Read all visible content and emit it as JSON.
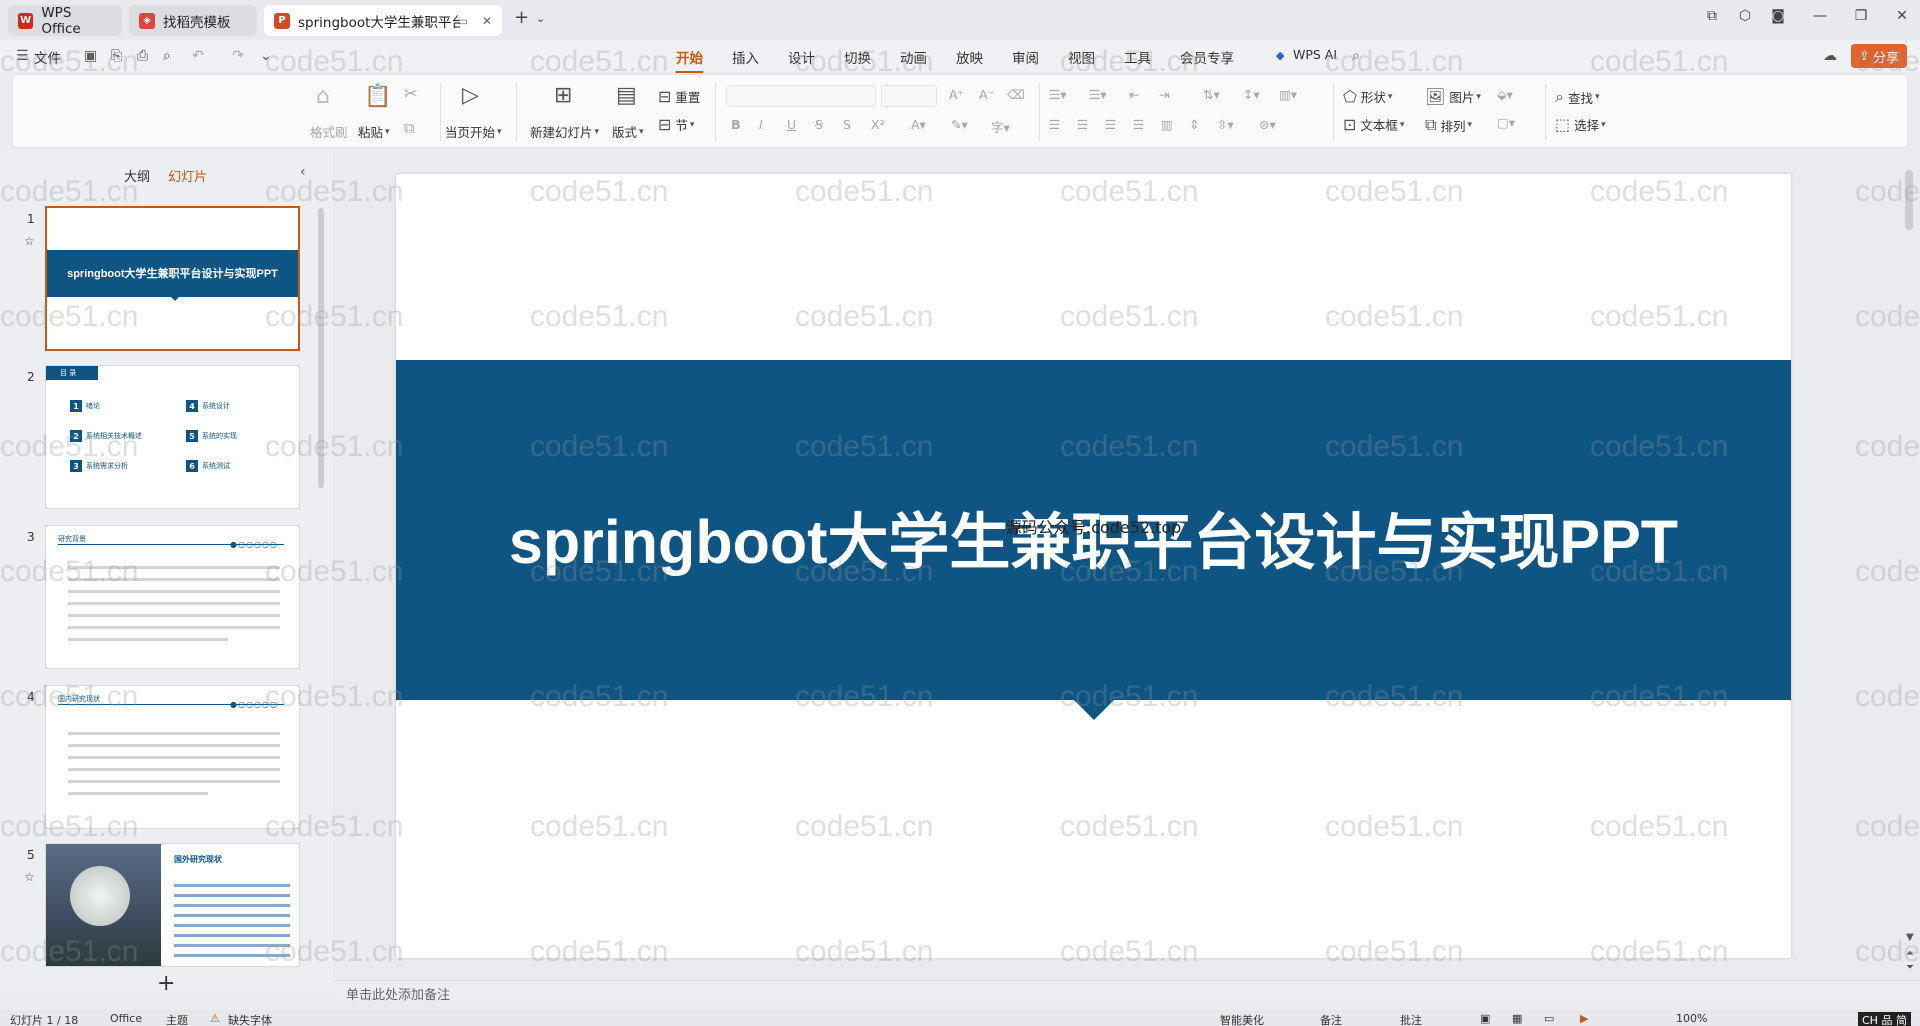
{
  "tabs": [
    {
      "label": "WPS Office",
      "icon": "wps-logo-icon",
      "active": false
    },
    {
      "label": "找稻壳模板",
      "icon": "docer-icon",
      "active": false
    },
    {
      "label": "springboot大学生兼职平台",
      "icon": "ppt-icon",
      "active": true
    }
  ],
  "menu": {
    "file": "文件",
    "items": [
      "开始",
      "插入",
      "设计",
      "切换",
      "动画",
      "放映",
      "审阅",
      "视图",
      "工具",
      "会员专享"
    ],
    "active": "开始",
    "wps_ai": "WPS AI",
    "share": "分享"
  },
  "ribbon": {
    "format_painter": "格式刷",
    "paste": "粘贴",
    "play_from_current": "当页开始",
    "new_slide": "新建幻灯片",
    "layout": "版式",
    "reset": "重置",
    "section": "节",
    "shape": "形状",
    "picture": "图片",
    "textbox": "文本框",
    "arrange": "排列",
    "find": "查找",
    "select": "选择"
  },
  "left_panel": {
    "tabs": [
      "大纲",
      "幻灯片"
    ],
    "active_tab": "幻灯片",
    "slides": [
      {
        "number": "1",
        "title": "springboot大学生兼职平台设计与实现PPT"
      },
      {
        "number": "2",
        "header": "目 录",
        "toc": [
          {
            "n": "1",
            "label": "绪论"
          },
          {
            "n": "4",
            "label": "系统设计"
          },
          {
            "n": "2",
            "label": "系统相关技术概述"
          },
          {
            "n": "5",
            "label": "系统的实现"
          },
          {
            "n": "3",
            "label": "系统需求分析"
          },
          {
            "n": "6",
            "label": "系统测试"
          }
        ]
      },
      {
        "number": "3",
        "header": "研究背景"
      },
      {
        "number": "4",
        "header": "国内研究现状"
      },
      {
        "number": "5",
        "header": "国外研究现状"
      }
    ]
  },
  "slide": {
    "title": "springboot大学生兼职平台设计与实现PPT",
    "overlay_text": "源码公众号:code52.top"
  },
  "notes_placeholder": "单击此处添加备注",
  "status": {
    "slide_info": "幻灯片 1 / 18",
    "office": "Office",
    "theme": "主题",
    "font_missing": "缺失字体",
    "smart_beautify": "智能美化",
    "notes": "备注",
    "comments": "批注",
    "zoom": "100%",
    "ime": "CH 品 简"
  },
  "watermark": "code51.cn",
  "colors": {
    "accent": "#c55a11",
    "slide_band": "#0e5584",
    "share": "#e2622a"
  }
}
